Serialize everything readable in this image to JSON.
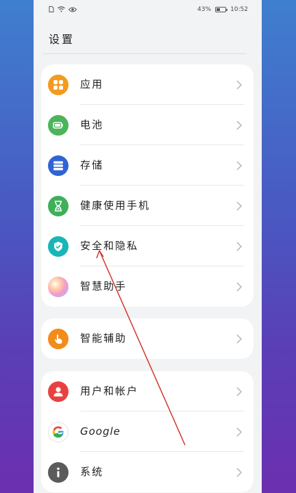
{
  "status_bar": {
    "battery": "43%",
    "time": "10:52",
    "battery_level": 0.43
  },
  "page": {
    "title": "设置"
  },
  "groups": [
    {
      "items": [
        {
          "label": "应用",
          "icon": "apps-icon",
          "color": "#f49a1f"
        },
        {
          "label": "电池",
          "icon": "battery-icon",
          "color": "#4cb45a"
        },
        {
          "label": "存储",
          "icon": "storage-icon",
          "color": "#2f64d6"
        },
        {
          "label": "健康使用手机",
          "icon": "hourglass-icon",
          "color": "#3fb05a"
        },
        {
          "label": "安全和隐私",
          "icon": "shield-icon",
          "color": "#18b6b6"
        },
        {
          "label": "智慧助手",
          "icon": "assistant-orb-icon",
          "color": "#f0a3c7"
        }
      ]
    },
    {
      "items": [
        {
          "label": "智能辅助",
          "icon": "hand-pointer-icon",
          "color": "#f28c1b"
        }
      ]
    },
    {
      "items": [
        {
          "label": "用户和帐户",
          "icon": "user-icon",
          "color": "#e94141"
        },
        {
          "label": "Google",
          "icon": "google-icon",
          "color": "#ffffff"
        },
        {
          "label": "系统",
          "icon": "info-icon",
          "color": "#5b5b5b"
        }
      ]
    }
  ],
  "colors": {
    "annotation_line": "#d2372c",
    "chevron": "#b9bcc2"
  }
}
